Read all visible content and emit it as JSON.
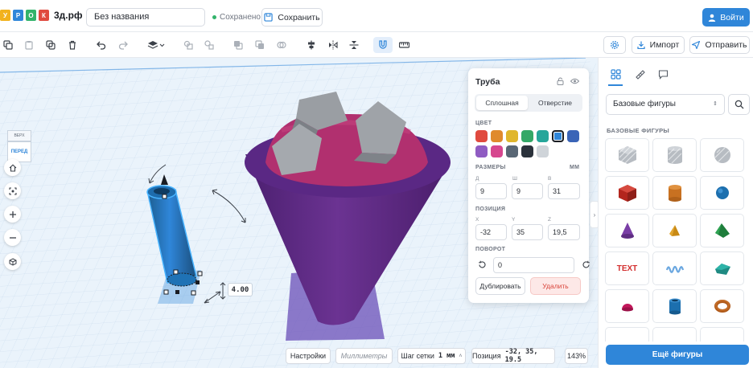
{
  "app": {
    "logo_letters": [
      "У",
      "Р",
      "О",
      "К"
    ],
    "logo_colors": [
      "#f2b21d",
      "#2f86d9",
      "#33b36b",
      "#e04a3f"
    ],
    "logo_domain": "3д.рф",
    "title": "Без названия",
    "save_status": "Сохранено",
    "save_label": "Сохранить",
    "login_label": "Войти"
  },
  "toolbar": {
    "tools": [
      "copy-icon",
      "paste-icon",
      "duplicate-icon",
      "delete-icon",
      "undo-icon",
      "redo-icon",
      "view-dropdown-icon",
      "group-icon",
      "ungroup-icon",
      "align-left-icon",
      "align-center-icon",
      "align-right-icon",
      "align-icon",
      "mirror-icon",
      "flip-icon",
      "magnet-icon",
      "ruler-icon"
    ],
    "settings_icon": "gear-icon",
    "import_label": "Импорт",
    "send_label": "Отправить"
  },
  "viewcube": {
    "top_label": "ВЕРХ",
    "front_label": "ПЕРЕД"
  },
  "dimension_label": "4.00",
  "shape_panel": {
    "title": "Труба",
    "solid_label": "Сплошная",
    "hole_label": "Отверстие",
    "color_caption": "ЦВЕТ",
    "colors": [
      "#e04a3f",
      "#e08a2c",
      "#e0b62c",
      "#33a867",
      "#26a69a",
      "#2f86d9",
      "#3a64b7",
      "#8f5cc2",
      "#d6478f",
      "#596775",
      "#2b323b",
      "#cfd4d9"
    ],
    "selected_color": "#2f86d9",
    "size_caption": "РАЗМЕРЫ",
    "units": "ММ",
    "size_labels": [
      "Д",
      "Ш",
      "В"
    ],
    "sizes": [
      "9",
      "9",
      "31"
    ],
    "position_caption": "ПОЗИЦИЯ",
    "position_labels": [
      "X",
      "Y",
      "Z"
    ],
    "positions": [
      "-32",
      "35",
      "19,5"
    ],
    "rotation_caption": "ПОВОРОТ",
    "rotation": "0",
    "duplicate_label": "Дублировать",
    "delete_label": "Удалить"
  },
  "sidebar": {
    "tabs": [
      "shapes-grid-icon",
      "ruler-icon",
      "comment-icon"
    ],
    "category": "Базовые фигуры",
    "section_caption": "БАЗОВЫЕ ФИГУРЫ",
    "tile_text_label": "TEXT",
    "more_label": "Ещё фигуры"
  },
  "status": {
    "settings_label": "Настройки",
    "units_label": "Миллиметры",
    "grid_label": "Шаг сетки",
    "grid_value": "1 мм",
    "position_label": "Позиция",
    "position_value": "-32, 35, 19.5",
    "zoom": "143%"
  }
}
